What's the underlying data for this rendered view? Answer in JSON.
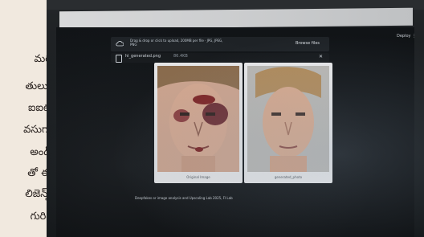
{
  "side_text": {
    "lines": [
      "మరీ",
      "తులు,",
      "ఐఐటీ",
      "వసుగా",
      "అండ్",
      "తో ఈ",
      "లిజెన్స్",
      "గురిం"
    ]
  },
  "screen": {
    "upload_text": "Drag & drop or click to upload, 200MB per file · JPG, JPEG, PNG",
    "browse_button": "Browse files",
    "right_menu": "Deploy ⋮",
    "file_name": "hi_generated.png",
    "file_size": "86.4KB",
    "close_symbol": "✕",
    "image_left_caption": "Original Image",
    "image_right_caption": "generated_photo",
    "footer_text": "Deepfakes or image analysis and Upscaling Lab 2025, Fl Lab"
  }
}
